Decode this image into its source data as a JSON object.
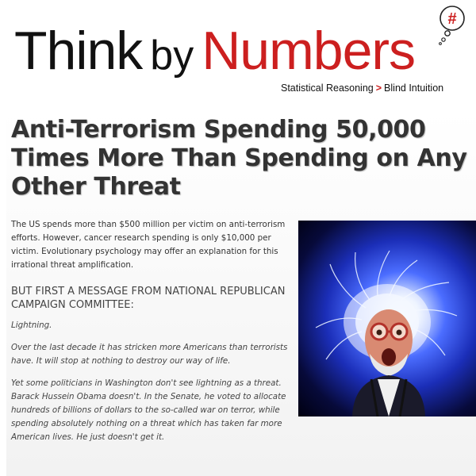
{
  "site": {
    "logo_think": "Think",
    "logo_by": "by",
    "logo_numbers": "Numbers",
    "bubble_symbol": "#",
    "tagline_left": "Statistical Reasoning",
    "tagline_arrow": ">",
    "tagline_right": "Blind Intuition",
    "icon": "thought-bubble-hash-icon"
  },
  "article": {
    "title": "Anti-Terrorism Spending 50,000 Times More Than Spending on Any Other Threat",
    "intro": "The US spends more than $500 million per victim on anti-terrorism efforts.  However, cancer research spending is only $10,000 per victim.  Evolutionary psychology may offer an explanation for this irrational threat amplification.",
    "ad_heading": "BUT FIRST A MESSAGE FROM NATIONAL REPUBLICAN CAMPAIGN COMMITTEE:",
    "quotes": [
      "Lightning.",
      "Over the last decade it has stricken more Americans than terrorists have. It will stop at nothing to destroy our way of life.",
      "Yet some politicians in Washington don't see lightning as a threat. Barack Hussein Obama doesn't. In the Senate, he voted to allocate hundreds of billions of dollars to the so-called war on terror, while spending absolutely nothing on a threat which has taken far more American lives. He just doesn't get it."
    ]
  },
  "colors": {
    "brand_red": "#cc1f1f",
    "text_dark": "#333333",
    "photo_blue": "#1b2eb8"
  }
}
